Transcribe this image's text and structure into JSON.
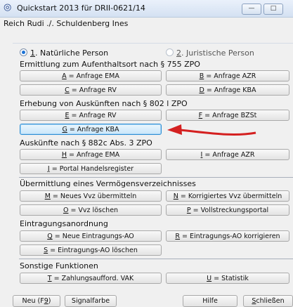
{
  "window": {
    "title": "Quickstart 2013 für DRII-0621/14",
    "subtitle": "Reich Rudi ./. Schuldenberg Ines",
    "min_glyph": "—",
    "max_glyph": "□"
  },
  "mode": {
    "natural": {
      "key": "1",
      "rest": ". Natürliche Person",
      "selected": true
    },
    "juristic": {
      "key": "2",
      "rest": ". Juristische Person",
      "selected": false
    }
  },
  "sections": {
    "s755": "Ermittlung zum Aufenthaltsort nach § 755 ZPO",
    "s802": "Erhebung von Auskünften nach § 802 l ZPO",
    "s882": "Auskünfte nach § 882c Abs. 3 ZPO",
    "verm": "Übermittlung eines Vermögensverzeichnisses",
    "eintr": "Eintragungsanordnung",
    "sonst": "Sonstige Funktionen"
  },
  "buttons": {
    "a": {
      "key": "A",
      "rest": " = Anfrage EMA"
    },
    "b": {
      "key": "B",
      "rest": " = Anfrage AZR"
    },
    "c": {
      "key": "C",
      "rest": " = Anfrage RV"
    },
    "d": {
      "key": "D",
      "rest": " = Anfrage KBA"
    },
    "e": {
      "key": "E",
      "rest": " = Anfrage RV"
    },
    "f": {
      "key": "F",
      "rest": " = Anfrage BZSt"
    },
    "g": {
      "key": "G",
      "rest": " = Anfrage KBA"
    },
    "h": {
      "key": "H",
      "rest": " = Anfrage EMA"
    },
    "i": {
      "key": "I",
      "rest": " = Anfrage AZR"
    },
    "j": {
      "key": "J",
      "rest": " = Portal Handelsregister"
    },
    "m": {
      "key": "M",
      "rest": " = Neues Vvz übermitteln"
    },
    "n": {
      "key": "N",
      "rest": " = Korrigiertes Vvz übermitteln"
    },
    "o": {
      "key": "O",
      "rest": " = Vvz löschen"
    },
    "p": {
      "key": "P",
      "rest": " = Vollstreckungsportal"
    },
    "q": {
      "key": "Q",
      "rest": " = Neue Eintragungs-AO"
    },
    "r": {
      "key": "R",
      "rest": " = Eintragungs-AO korrigieren"
    },
    "s": {
      "key": "S",
      "rest": " = Eintragungs-AO löschen"
    },
    "t": {
      "key": "T",
      "rest": " = Zahlungsaufford. VAK"
    },
    "uu": {
      "key": "U",
      "rest": " = Statistik"
    }
  },
  "footer": {
    "new_pre": "Neu (F",
    "new_key": "9",
    "new_post": ")",
    "signal": "Signalfarbe",
    "help": "Hilfe",
    "close_key": "S",
    "close_rest": "chließen"
  },
  "colors": {
    "accent_arrow": "#d42020",
    "active_button": "#2d8fd4"
  }
}
